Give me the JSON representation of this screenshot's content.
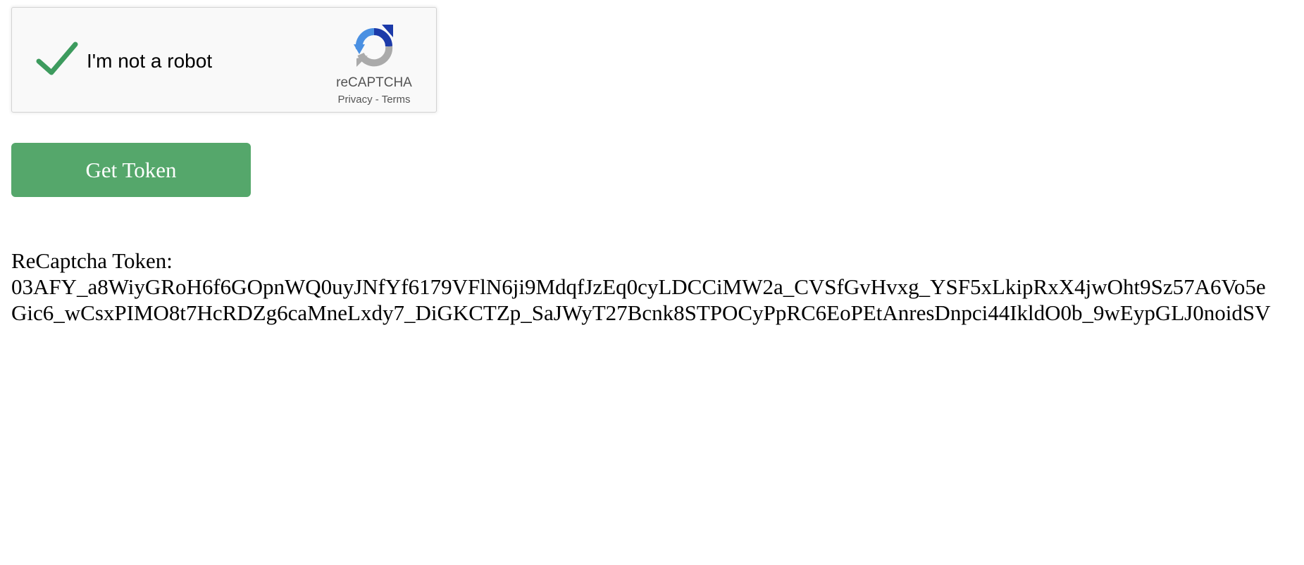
{
  "recaptcha": {
    "checkbox_label": "I'm not a robot",
    "checked": true,
    "brand": "reCAPTCHA",
    "privacy_link": "Privacy",
    "separator": " - ",
    "terms_link": "Terms",
    "check_color": "#3d9b5e",
    "icons": {
      "check": "checkmark-icon",
      "logo": "recaptcha-logo-icon"
    }
  },
  "button": {
    "label": "Get Token",
    "color": "#55a76b"
  },
  "token": {
    "heading": "ReCaptcha Token:",
    "line1": "03AFY_a8WiyGRoH6f6GOpnWQ0uyJNfYf6179VFlN6ji9MdqfJzEq0cyLDCCiMW2a_CVSfGvHvxg_YSF5xLkipRxX4jwOht9Sz57A6Vo5e",
    "line2": "Gic6_wCsxPIMO8t7HcRDZg6caMneLxdy7_DiGKCTZp_SaJWyT27Bcnk8STPOCyPpRC6EoPEtAnresDnpci44IkldO0b_9wEypGLJ0noidSV"
  }
}
